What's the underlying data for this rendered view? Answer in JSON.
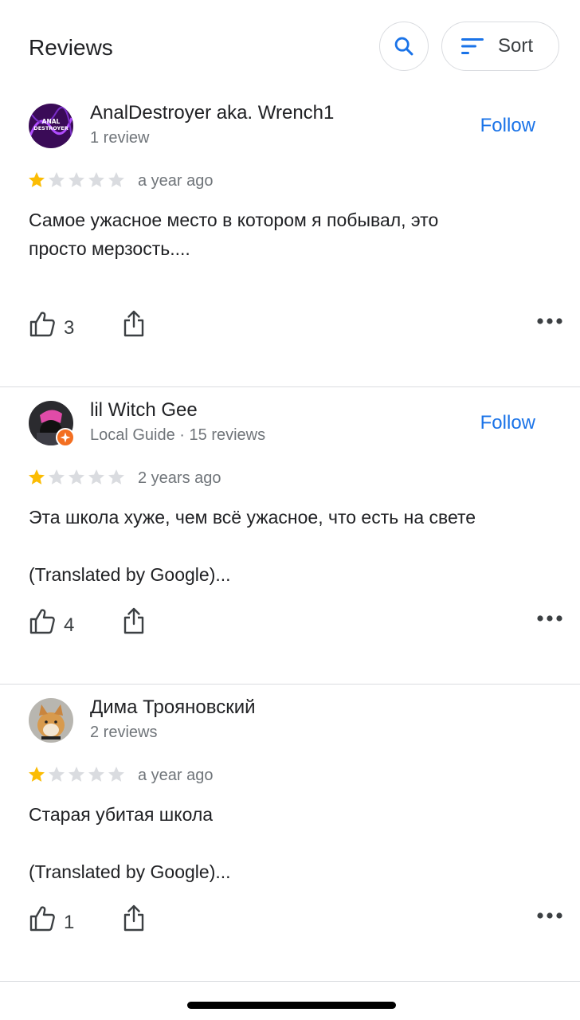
{
  "header": {
    "title": "Reviews",
    "search_icon": "search-icon",
    "sort_label": "Sort",
    "sort_icon": "sort-icon"
  },
  "colors": {
    "accent": "#1a73e8",
    "star_filled": "#fbbc04",
    "star_empty": "#dadce0",
    "local_guide_badge": "#f36f21"
  },
  "reviews": [
    {
      "name": "AnalDestroyer aka. Wrench1",
      "meta": "1 review",
      "follow_label": "Follow",
      "rating": 1,
      "time": "a year ago",
      "text": [
        "Самое ужасное место в котором я побывал, это",
        "просто мерзость...."
      ],
      "likes": "3",
      "avatar_text": [
        "ANAL",
        "DESTROYER"
      ]
    },
    {
      "name": "lil Witch Gee",
      "meta": "Local Guide · 15 reviews",
      "follow_label": "Follow",
      "rating": 1,
      "time": "2 years ago",
      "text": [
        "Эта школа хуже, чем всё ужасное, что есть на свете",
        "",
        "(Translated by Google)..."
      ],
      "likes": "4"
    },
    {
      "name": "Дима Трояновский",
      "meta": "2 reviews",
      "rating": 1,
      "time": "a year ago",
      "text": [
        "Старая убитая школа",
        "",
        "(Translated by Google)..."
      ],
      "likes": "1"
    }
  ]
}
